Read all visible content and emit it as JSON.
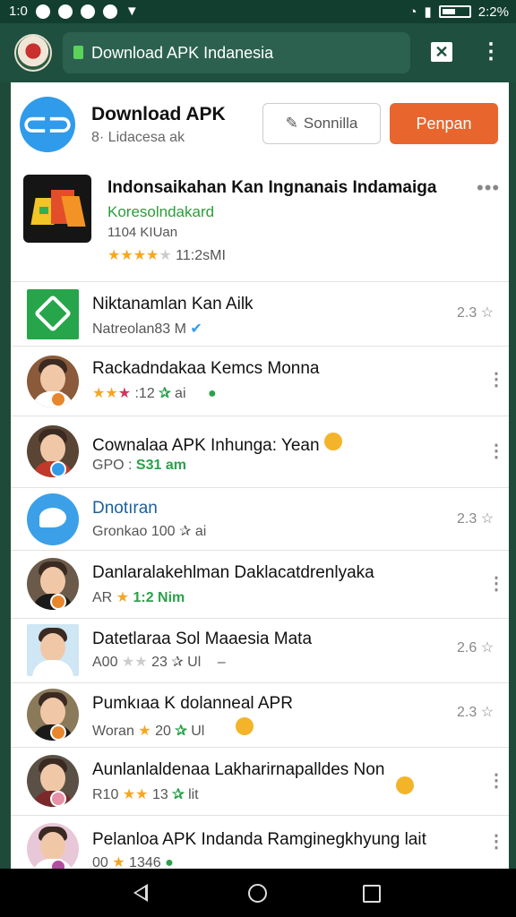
{
  "status_bar": {
    "time": "1:0",
    "clock_right": "2:2%",
    "icons_left": [
      "notification-icon",
      "sync-icon",
      "settings-icon",
      "compass-icon",
      "location-icon"
    ],
    "icons_right": [
      "wifi-icon",
      "signal-icon",
      "battery-icon"
    ]
  },
  "browser": {
    "url": "Download APK Indanesia"
  },
  "header": {
    "title": "Download APK",
    "subtitle": "8· Lidacesa ak",
    "btn_secondary": "Sonnilla",
    "btn_primary": "Penpan"
  },
  "featured": {
    "title": "Indonsaikahan Kan Ingnanais Indamaiga",
    "developer": "Koresolndakard",
    "meta": "1104 KIUan",
    "rating_stars": 4,
    "rating_text": "11:2sMI",
    "more": "•••"
  },
  "list": [
    {
      "title": "Niktanamlan Kan Ailk",
      "sub_a": "Natreolan83 M",
      "score": "2.3"
    },
    {
      "title": "Rackadndakaa Kemcs Monna",
      "sub_a": ":12",
      "sub_b": "ai",
      "dots": "⋮"
    },
    {
      "title": "Cownalaa APK Inhunga: Yean",
      "sub_a": "GPO :",
      "sub_b": "S31 am",
      "dots": "⋮"
    },
    {
      "title": "Dnotıran",
      "sub_a": "Gronkao 100",
      "sub_b": "ai",
      "score": "2.3"
    },
    {
      "title": "Danlaralakehlman Daklacatdrenlyaka",
      "sub_a": "AR",
      "sub_b": "1:2 Nim",
      "dots": "⋮"
    },
    {
      "title": "Datetlaraa Sol Maaesia Mata",
      "sub_a": "A00",
      "sub_b": "23",
      "sub_c": "Ul",
      "score": "2.6"
    },
    {
      "title": "Pumkıaa K dolanneal APR",
      "sub_a": "Woran",
      "sub_b": "20",
      "sub_c": "Ul",
      "score": "2.3"
    },
    {
      "title": "Aunlanlaldenaa Lakharirnapalldes Non",
      "sub_a": "R10",
      "sub_b": "13",
      "sub_c": "lit",
      "dots": "⋮"
    },
    {
      "title": "Pelanloa APK Indanda Ramginegkhyung lait",
      "sub_a": "00",
      "sub_b": "1346",
      "dots": "⋮"
    }
  ],
  "colors": {
    "app_bar": "#1f4f3e",
    "accent_orange": "#e8662d",
    "developer_green": "#2a9d3a",
    "star": "#f5a623",
    "blue_logo": "#2f9bea"
  }
}
